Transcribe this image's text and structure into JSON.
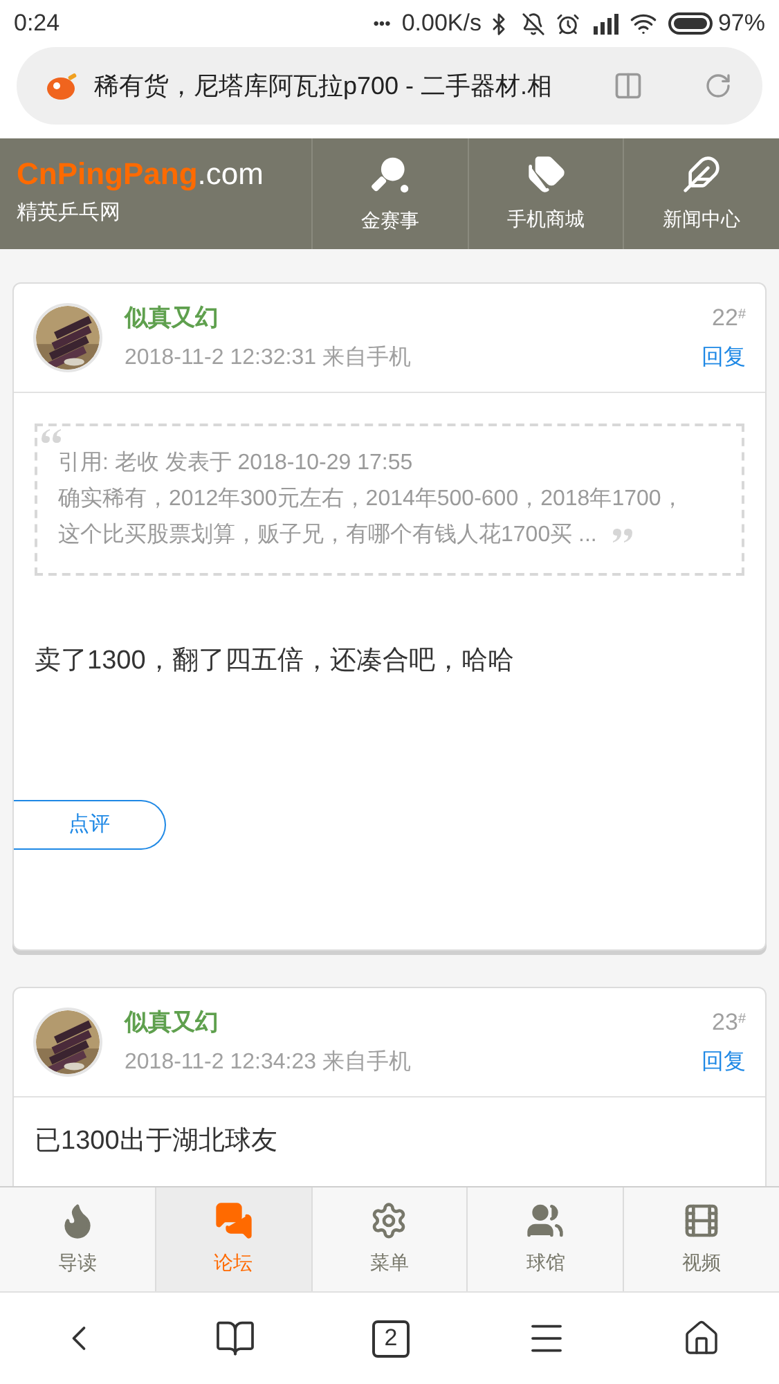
{
  "status_bar": {
    "time": "0:24",
    "dots": "•••",
    "speed": "0.00K/s",
    "battery": "97%"
  },
  "address_bar": {
    "title": "稀有货，尼塔库阿瓦拉p700 - 二手器材.相"
  },
  "site_header": {
    "logo_main": "CnPingPang",
    "logo_suffix": ".com",
    "subtitle": "精英乒乓网",
    "nav": [
      {
        "label": "金赛事",
        "kind": "paddle"
      },
      {
        "label": "手机商城",
        "kind": "tags"
      },
      {
        "label": "新闻中心",
        "kind": "feather"
      }
    ]
  },
  "posts": [
    {
      "author": "似真又幻",
      "timestamp": "2018-11-2 12:32:31 来自手机",
      "floor": "22",
      "floor_mark": "#",
      "reply": "回复",
      "quote": {
        "header": "引用: 老收 发表于 2018-10-29 17:55",
        "lines": [
          "确实稀有，2012年300元左右，2014年500-600，2018年1700，",
          "这个比买股票划算，贩子兄，有哪个有钱人花1700买 ..."
        ]
      },
      "text": "卖了1300，翻了四五倍，还凑合吧，哈哈",
      "review_button": "点评"
    },
    {
      "author": "似真又幻",
      "timestamp": "2018-11-2 12:34:23 来自手机",
      "floor": "23",
      "floor_mark": "#",
      "reply": "回复",
      "text": "已1300出于湖北球友"
    }
  ],
  "tab_bar": [
    {
      "label": "导读",
      "kind": "flame",
      "selected": false
    },
    {
      "label": "论坛",
      "kind": "chat",
      "selected": true
    },
    {
      "label": "菜单",
      "kind": "gear",
      "selected": false
    },
    {
      "label": "球馆",
      "kind": "people",
      "selected": false
    },
    {
      "label": "视频",
      "kind": "film",
      "selected": false
    }
  ],
  "browser_nav": {
    "tab_count": "2"
  }
}
